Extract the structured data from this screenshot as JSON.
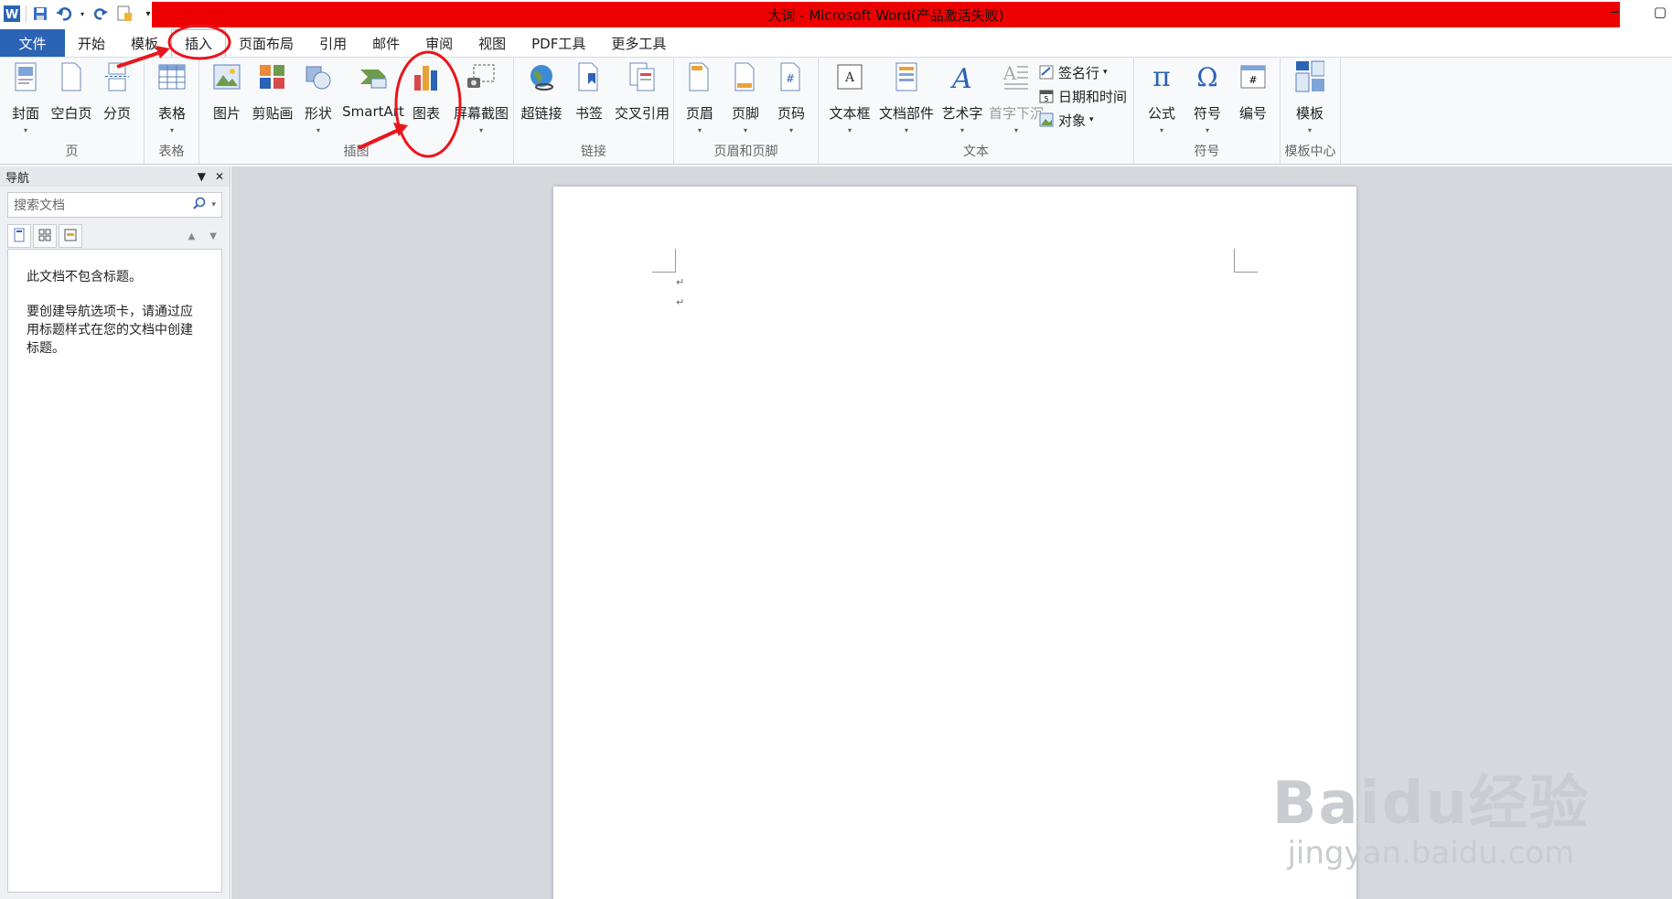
{
  "window": {
    "title": "大词 - Microsoft Word(产品激活失败)",
    "minimize": "−",
    "restore": "▢"
  },
  "tabs": [
    "文件",
    "开始",
    "模板",
    "插入",
    "页面布局",
    "引用",
    "邮件",
    "审阅",
    "视图",
    "PDF工具",
    "更多工具"
  ],
  "active_tab": "插入",
  "ribbon": {
    "groups": {
      "page": "页",
      "table": "表格",
      "illustrations": "插图",
      "links": "链接",
      "header_footer": "页眉和页脚",
      "text": "文本",
      "symbols": "符号",
      "template_center": "模板中心"
    },
    "buttons": {
      "cover": "封面",
      "blank_page": "空白页",
      "page_break": "分页",
      "table": "表格",
      "picture": "图片",
      "clipart": "剪贴画",
      "shapes": "形状",
      "smartart": "SmartArt",
      "chart": "图表",
      "screenshot": "屏幕截图",
      "hyperlink": "超链接",
      "bookmark": "书签",
      "cross_ref": "交叉引用",
      "header": "页眉",
      "footer": "页脚",
      "page_number": "页码",
      "textbox": "文本框",
      "quick_parts": "文档部件",
      "wordart": "艺术字",
      "dropcap": "首字下沉",
      "signature": "签名行",
      "datetime": "日期和时间",
      "object": "对象",
      "equation": "公式",
      "symbol": "符号",
      "numbering": "编号",
      "template": "模板"
    }
  },
  "nav": {
    "title": "导航",
    "search_placeholder": "搜索文档",
    "no_headings": "此文档不包含标题。",
    "hint": "要创建导航选项卡，请通过应用标题样式在您的文档中创建标题。"
  },
  "document": {
    "paragraph_mark": "↵"
  },
  "watermark": {
    "brand": "Baidu经验",
    "url": "jingyan.baidu.com"
  },
  "colors": {
    "title_bar": "#ee0000",
    "file_tab": "#2b63b5",
    "annotation": "#e8161c"
  }
}
